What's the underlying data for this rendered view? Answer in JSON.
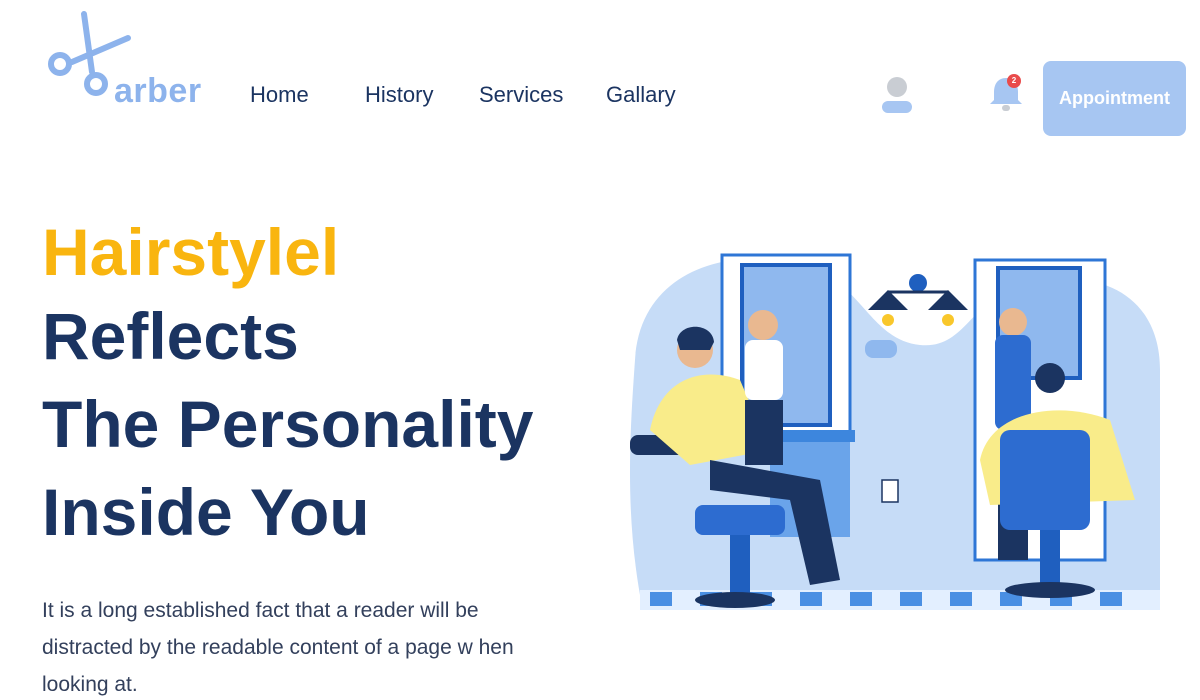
{
  "header": {
    "logo_text": "arber",
    "nav": [
      {
        "label": "Home"
      },
      {
        "label": "History"
      },
      {
        "label": "Services"
      },
      {
        "label": "Gallary"
      }
    ],
    "user_icon": "user-icon",
    "bell_icon": "bell-icon",
    "notification_count": "2",
    "appointment_label": "Appointment"
  },
  "hero": {
    "title_accent": "Hairstylel",
    "title_lines": [
      "Reflects",
      "The Personality",
      "Inside You"
    ],
    "description": "It is a long established fact that a reader will be distracted by the readable content of a page w hen looking at."
  },
  "colors": {
    "accent": "#f9b50f",
    "primary_dark": "#1b3461",
    "brand_light": "#8db3ec",
    "button": "#a7c6f2",
    "badge": "#e94b4b"
  }
}
